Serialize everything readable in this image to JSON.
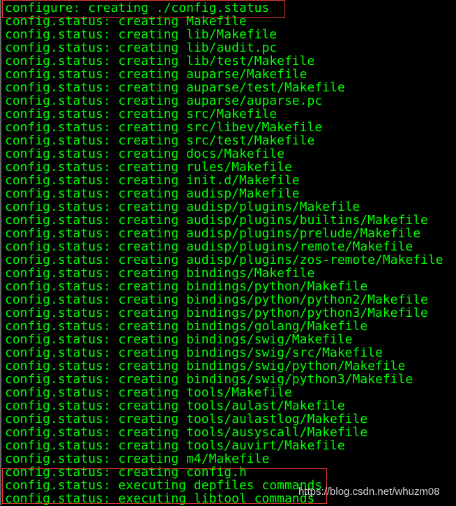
{
  "terminal": {
    "text_color": "#00ff00",
    "background": "#000000",
    "highlight_color": "#e53935",
    "lines": [
      "configure: creating ./config.status",
      "config.status: creating Makefile",
      "config.status: creating lib/Makefile",
      "config.status: creating lib/audit.pc",
      "config.status: creating lib/test/Makefile",
      "config.status: creating auparse/Makefile",
      "config.status: creating auparse/test/Makefile",
      "config.status: creating auparse/auparse.pc",
      "config.status: creating src/Makefile",
      "config.status: creating src/libev/Makefile",
      "config.status: creating src/test/Makefile",
      "config.status: creating docs/Makefile",
      "config.status: creating rules/Makefile",
      "config.status: creating init.d/Makefile",
      "config.status: creating audisp/Makefile",
      "config.status: creating audisp/plugins/Makefile",
      "config.status: creating audisp/plugins/builtins/Makefile",
      "config.status: creating audisp/plugins/prelude/Makefile",
      "config.status: creating audisp/plugins/remote/Makefile",
      "config.status: creating audisp/plugins/zos-remote/Makefile",
      "config.status: creating bindings/Makefile",
      "config.status: creating bindings/python/Makefile",
      "config.status: creating bindings/python/python2/Makefile",
      "config.status: creating bindings/python/python3/Makefile",
      "config.status: creating bindings/golang/Makefile",
      "config.status: creating bindings/swig/Makefile",
      "config.status: creating bindings/swig/src/Makefile",
      "config.status: creating bindings/swig/python/Makefile",
      "config.status: creating bindings/swig/python3/Makefile",
      "config.status: creating tools/Makefile",
      "config.status: creating tools/aulast/Makefile",
      "config.status: creating tools/aulastlog/Makefile",
      "config.status: creating tools/ausyscall/Makefile",
      "config.status: creating tools/auvirt/Makefile",
      "config.status: creating m4/Makefile",
      "config.status: creating config.h",
      "config.status: executing depfiles commands",
      "config.status: executing libtool commands"
    ]
  },
  "watermark": "https://blog.csdn.net/whuzm08"
}
